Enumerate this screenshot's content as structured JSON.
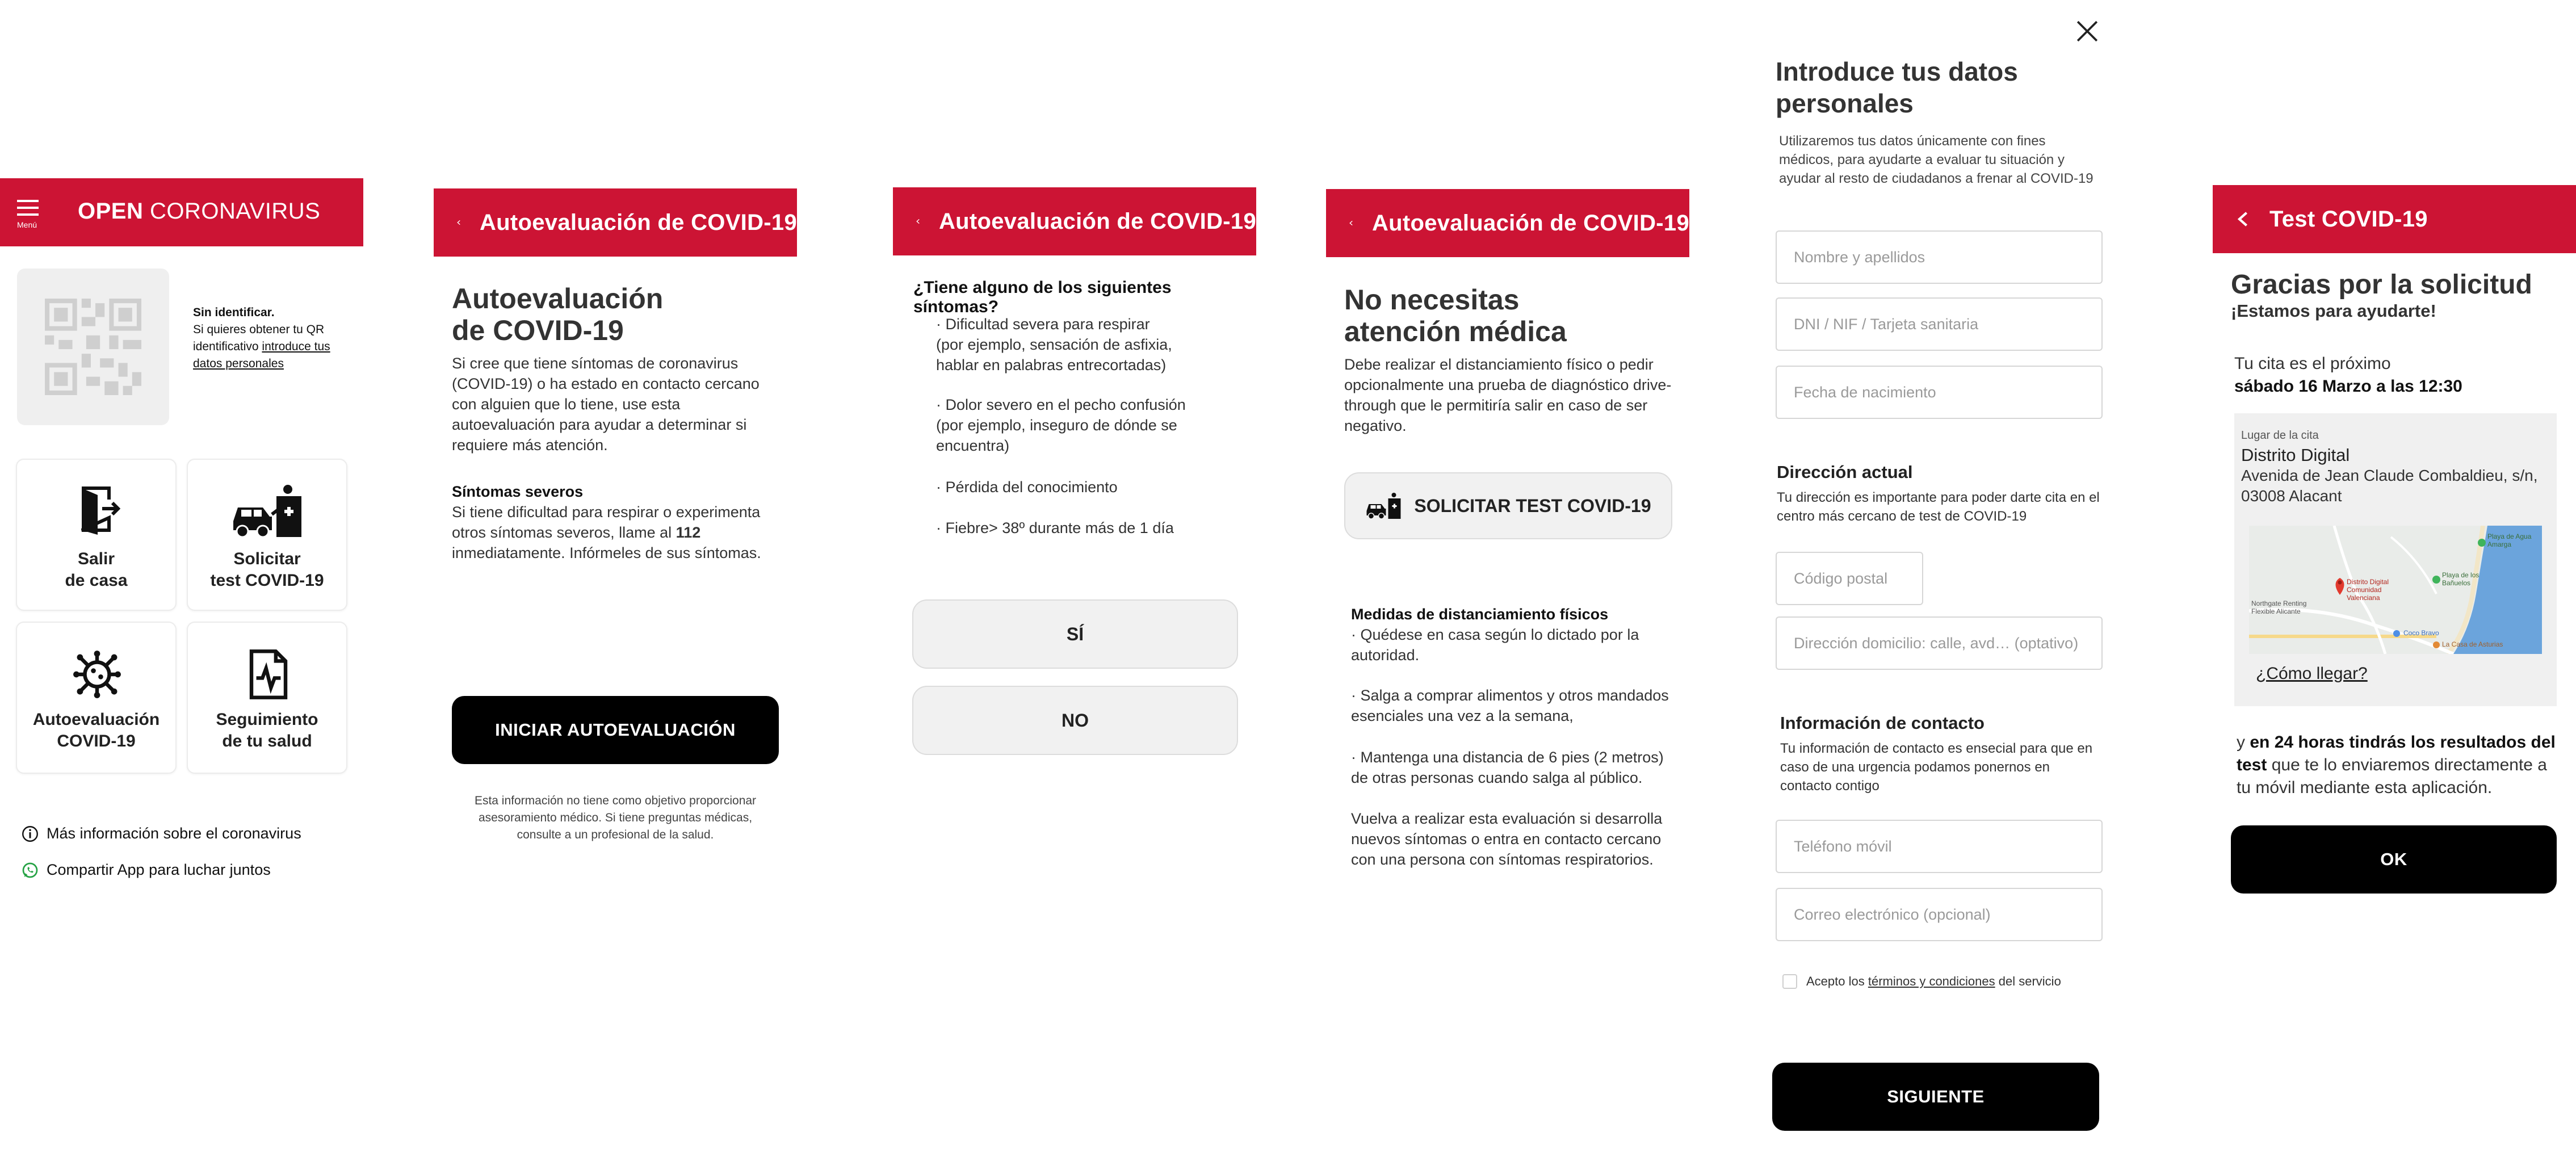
{
  "colors": {
    "brand_red": "#cc1434",
    "black": "#000000",
    "grey_button": "#f1f1f1"
  },
  "screen1": {
    "menu_label": "Menú",
    "app_title_bold": "OPEN",
    "app_title_light": "CORONAVIRUS",
    "qr_heading": "Sin identificar.",
    "qr_text": "Si quieres obtener tu QR identificativo",
    "qr_link": "introduce tus datos personales",
    "tiles": [
      {
        "label": "Salir\nde casa",
        "icon": "exit-door-icon"
      },
      {
        "label": "Solicitar\ntest COVID-19",
        "icon": "drive-through-test-icon"
      },
      {
        "label": "Autoevaluación\nCOVID-19",
        "icon": "virus-icon"
      },
      {
        "label": "Seguimiento\nde tu salud",
        "icon": "health-tracking-icon"
      }
    ],
    "more_info": "Más información sobre el coronavirus",
    "share": "Compartir App para luchar juntos"
  },
  "screen2": {
    "title": "Autoevaluación de COVID-19",
    "heading": "Autoevaluación de COVID-19",
    "intro": "Si cree que tiene síntomas de coronavirus (COVID-19) o ha estado en contacto cercano con alguien que lo tiene, use esta autoevaluación para ayudar a determinar si requiere más atención.",
    "severe_title": "Síntomas severos",
    "severe_text_1": "Si tiene dificultad para respirar o experimenta otros síntomas severos, llame al",
    "severe_number": "112",
    "severe_text_2": "inmediatamente. Infórmeles de sus síntomas.",
    "start_button": "INICIAR AUTOEVALUACIÓN",
    "disclaimer": "Esta información no tiene como objetivo proporcionar asesoramiento médico. Si tiene preguntas médicas, consulte a un profesional de la salud."
  },
  "screen3": {
    "title": "Autoevaluación de COVID-19",
    "question": "¿Tiene alguno de los siguientes síntomas?",
    "symptoms": [
      "· Dificultad severa para respirar\n  (por ejemplo, sensación de asfixia,\n  hablar en palabras entrecortadas)",
      "· Dolor severo en el pecho confusión\n  (por ejemplo, inseguro de dónde se\n  encuentra)",
      "· Pérdida del conocimiento",
      "· Fiebre> 38º durante más de 1 día"
    ],
    "yes": "SÍ",
    "no": "NO"
  },
  "screen4": {
    "title": "Autoevaluación de COVID-19",
    "heading": "No necesitas atención médica",
    "intro": "Debe realizar el distanciamiento físico o pedir opcionalmente una prueba de diagnóstico drive-through que le permitiría salir en caso de ser negativo.",
    "request_button": "SOLICITAR TEST COVID-19",
    "measures_title": "Medidas de distanciamiento físicos",
    "measures": [
      "· Quédese en casa según lo dictado por la autoridad.",
      "· Salga a comprar alimentos y otros mandados esenciales una vez a la semana,",
      "· Mantenga una distancia de 6 pies (2 metros) de otras personas cuando salga al público.",
      "Vuelva a realizar esta evaluación si desarrolla nuevos síntomas o entra en contacto cercano con una persona con síntomas respiratorios."
    ]
  },
  "screen5": {
    "heading": "Introduce tus datos personales",
    "intro": "Utilizaremos tus datos únicamente con fines médicos, para ayudarte a evaluar tu situación y ayudar al resto de ciudadanos a frenar al COVID-19",
    "placeholders": {
      "name": "Nombre y apellidos",
      "dni": "DNI / NIF / Tarjeta sanitaria",
      "birth": "Fecha de nacimiento",
      "postal": "Código postal",
      "address": "Dirección domicilio: calle, avd… (optativo)",
      "phone": "Teléfono móvil",
      "email": "Correo electrónico (opcional)"
    },
    "address_title": "Dirección actual",
    "address_text": "Tu dirección es importante para poder darte cita en el centro más cercano de test de COVID-19",
    "contact_title": "Información de contacto",
    "contact_text": "Tu información de contacto es ensecial para que en caso de una urgencia podamos ponernos en contacto contigo",
    "terms_pre": "Acepto los",
    "terms_link": "términos y condiciones",
    "terms_post": "del servicio",
    "next_button": "SIGUIENTE"
  },
  "screen6": {
    "title": "Test COVID-19",
    "heading": "Gracias por la solicitud",
    "subheading": "¡Estamos para ayudarte!",
    "appointment_pre": "Tu cita es el próximo",
    "appointment_date": "sábado 16 Marzo a las 12:30",
    "place_label": "Lugar de la cita",
    "place_name": "Distrito Digital",
    "place_address": "Avenida de Jean Claude Combaldieu, s/n, 03008 Alacant",
    "map_labels": [
      "Playa de Agua Amarga",
      "Distrito Digital Comunidad Valenciana",
      "Northgate Renting Flexible Alicante",
      "Playa de los Bañuelos",
      "Coco Bravo",
      "La Casa de Asturias"
    ],
    "directions": "¿Cómo llegar?",
    "results_pre": "y",
    "results_bold": "en 24 horas tindrás los resultados del test",
    "results_post": "que te lo enviaremos directamente a tu móvil mediante esta aplicación.",
    "ok_button": "OK"
  }
}
